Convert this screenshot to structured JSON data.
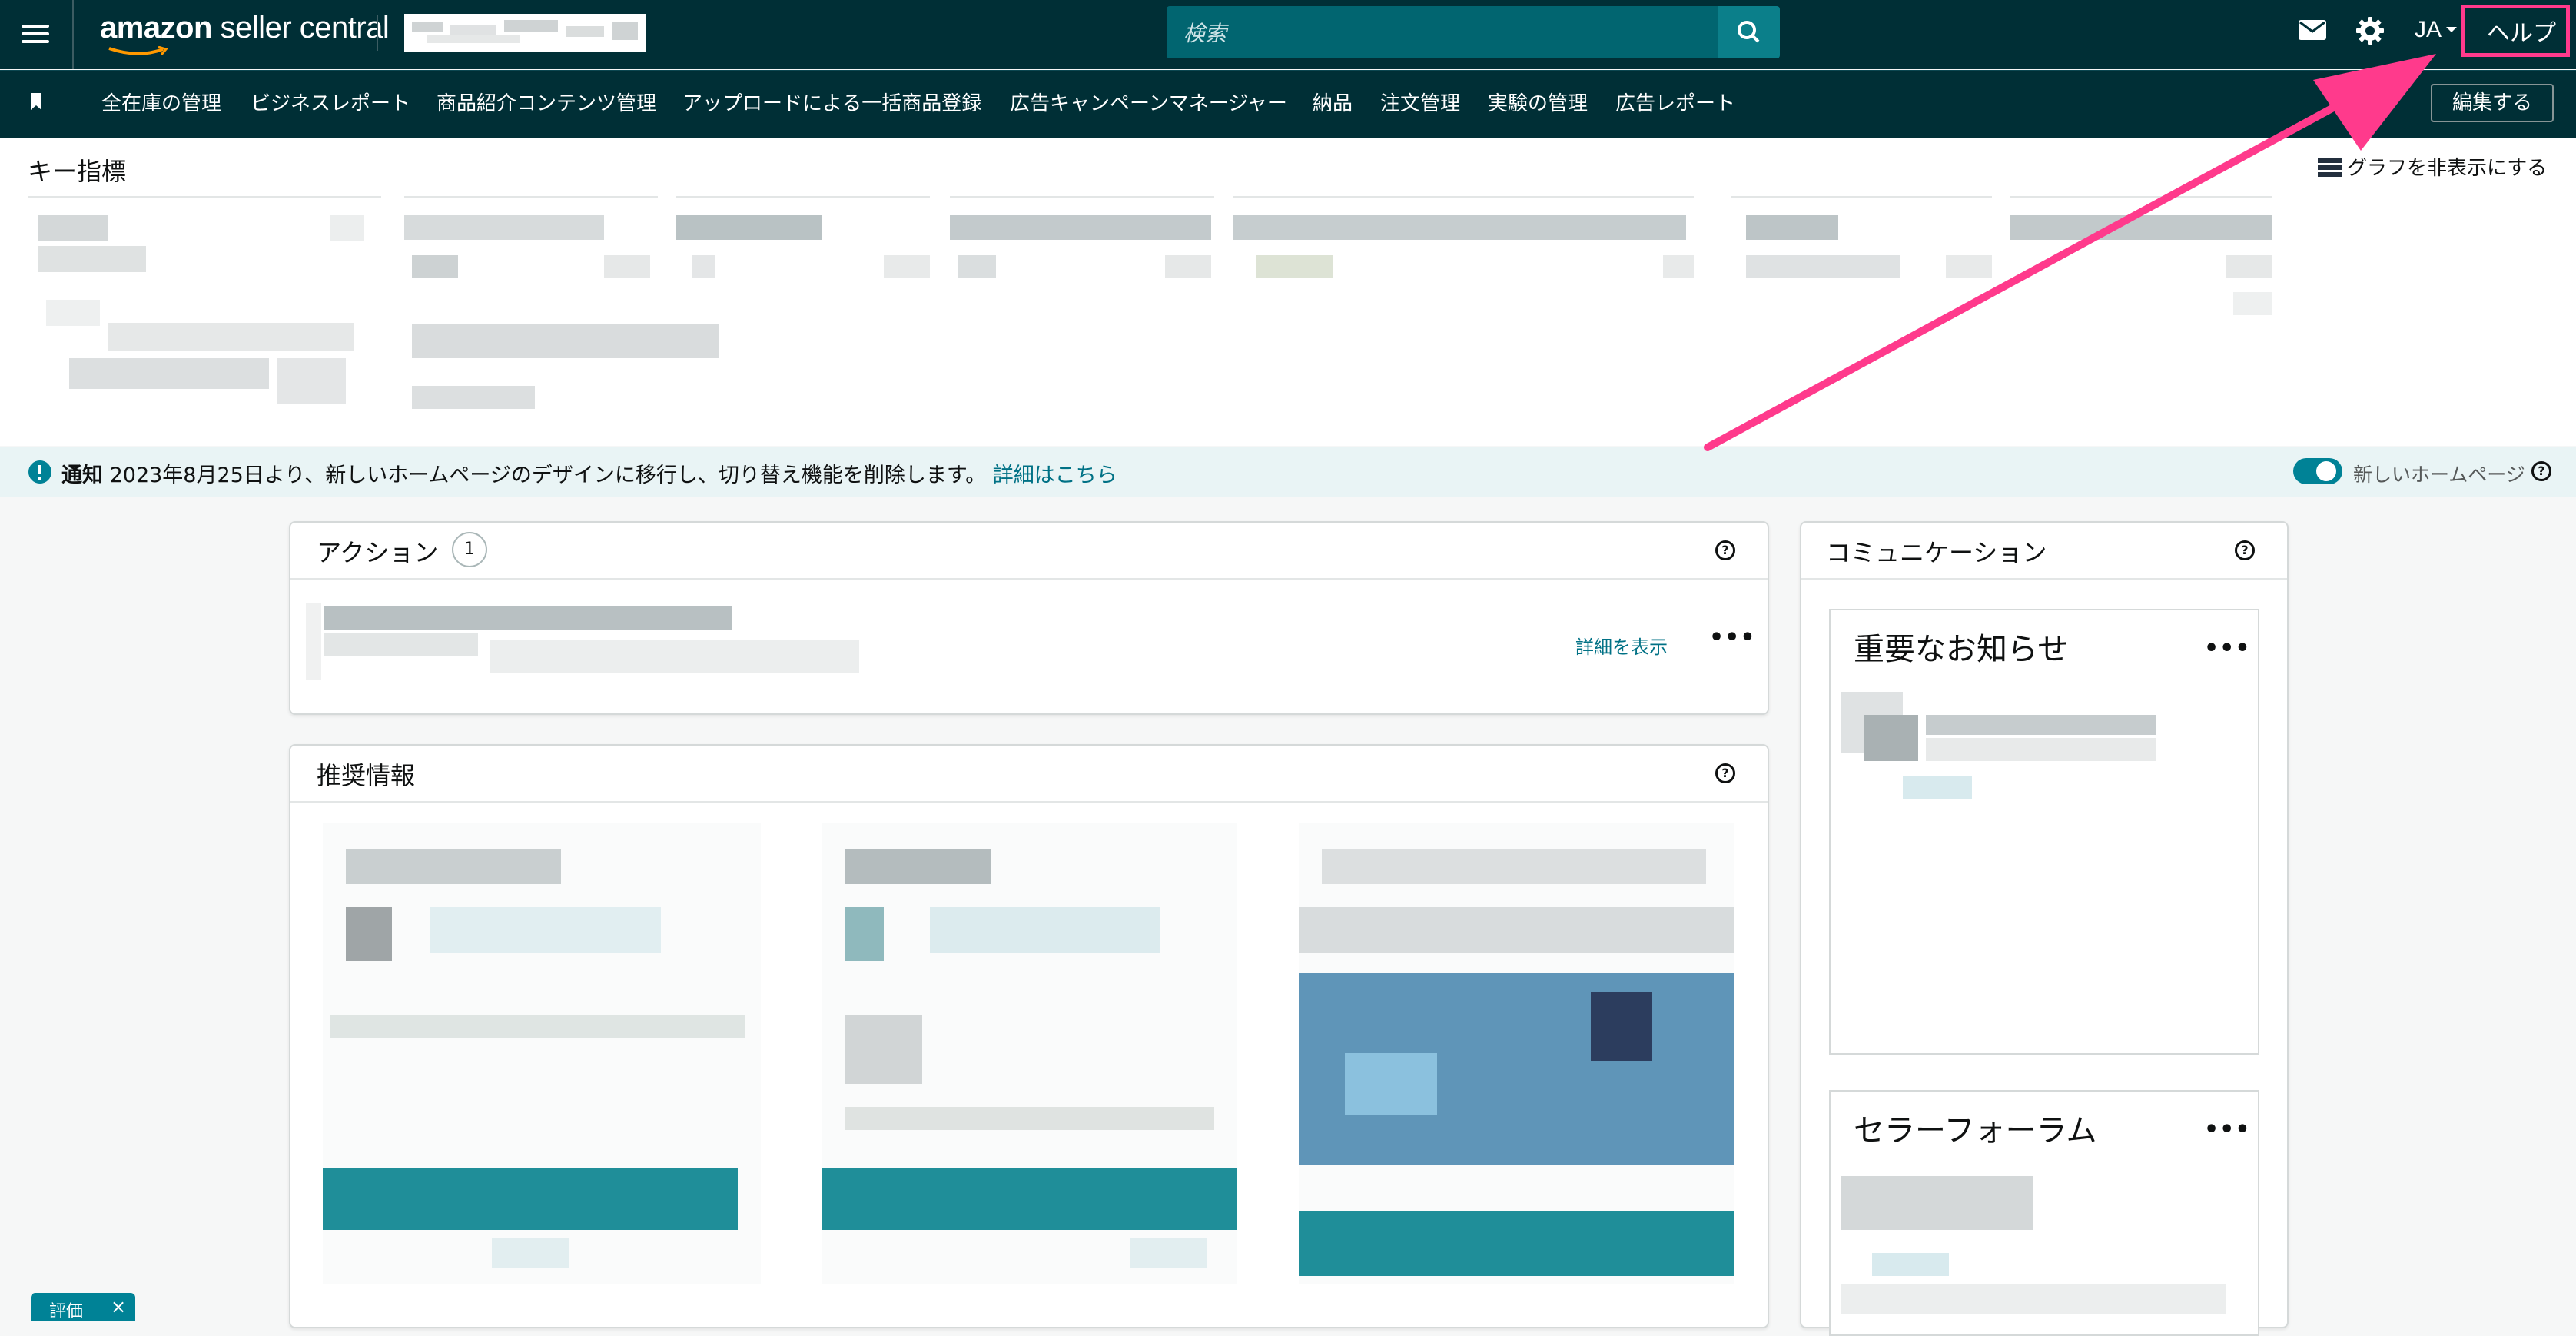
{
  "header": {
    "logo_text_bold": "amazon",
    "logo_text_rest": " seller central",
    "search_placeholder": "検索",
    "language": "JA",
    "help_label": "ヘルプ",
    "icons": [
      "menu-icon",
      "mail-icon",
      "gear-icon",
      "search-icon"
    ]
  },
  "nav": {
    "items": [
      "全在庫の管理",
      "ビジネスレポート",
      "商品紹介コンテンツ管理",
      "アップロードによる一括商品登録",
      "広告キャンペーンマネージャー",
      "納品",
      "注文管理",
      "実験の管理",
      "広告レポート"
    ],
    "edit_label": "編集する"
  },
  "metrics": {
    "title": "キー指標",
    "hide_graph_label": "グラフを非表示にする"
  },
  "notice": {
    "label": "通知",
    "text": "2023年8月25日より、新しいホームページのデザインに移行し、切り替え機能を削除します。",
    "link": "詳細はこちら",
    "toggle_label": "新しいホームページ"
  },
  "actions": {
    "title": "アクション",
    "count": "1",
    "details_link": "詳細を表示"
  },
  "recommendations": {
    "title": "推奨情報"
  },
  "communication": {
    "title": "コミュニケーション",
    "important_title": "重要なお知らせ",
    "forum_title": "セラーフォーラム"
  },
  "feedback_tab": {
    "label": "評価",
    "close": "×"
  },
  "colors": {
    "header_bg": "#002f36",
    "accent": "#008296",
    "link": "#007185",
    "highlight": "#ff3a8c"
  }
}
